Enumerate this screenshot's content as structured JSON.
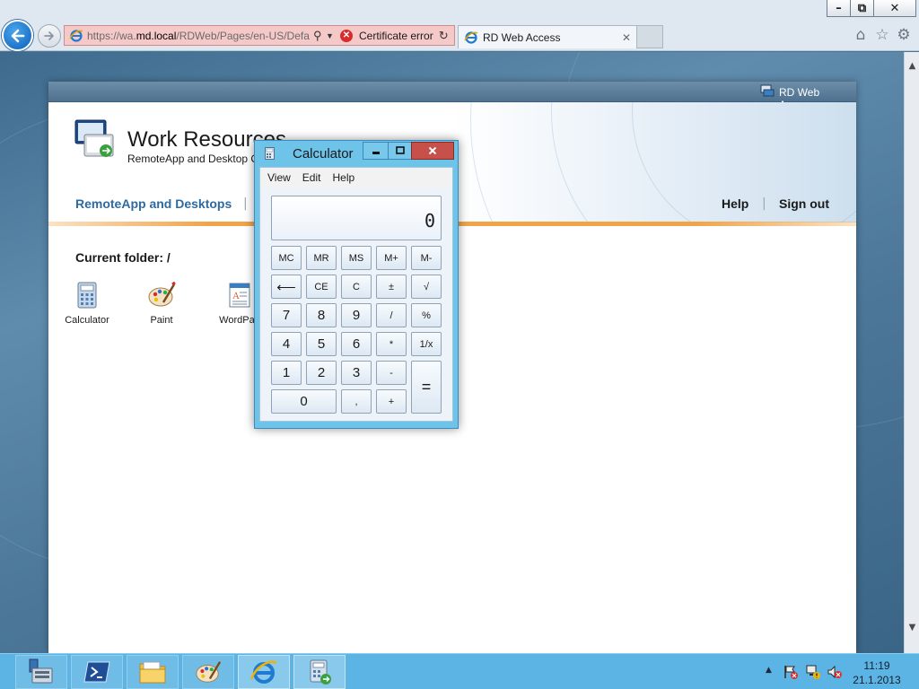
{
  "browser": {
    "address": {
      "url_prefix": "https://wa.",
      "url_host": "md.local",
      "url_path": "/RDWeb/Pages/en-US/Defa",
      "cert_error": "Certificate error"
    },
    "tab": {
      "label": "RD Web Access",
      "close": "✕"
    },
    "window_controls": {
      "minimize": "–",
      "restore": "⧉",
      "close": "✕"
    },
    "icons": [
      "home-icon",
      "favorites-icon",
      "gear-icon"
    ]
  },
  "page": {
    "topbar_title": "RD Web Access",
    "header_title": "Work Resources",
    "header_subtitle": "RemoteApp and Desktop C",
    "nav": {
      "remoteapp": "RemoteApp and Desktops",
      "separator": "|",
      "help": "Help",
      "signout": "Sign out"
    },
    "current_folder": "Current folder: /",
    "apps": [
      {
        "label": "Calculator"
      },
      {
        "label": "Paint"
      },
      {
        "label": "WordPad"
      }
    ]
  },
  "calculator": {
    "title": "Calculator",
    "menu": [
      "View",
      "Edit",
      "Help"
    ],
    "display": "0",
    "keys": {
      "memory": [
        "MC",
        "MR",
        "MS",
        "M+",
        "M-"
      ],
      "row2": [
        "⟵",
        "CE",
        "C",
        "±",
        "√"
      ],
      "row3": [
        "7",
        "8",
        "9",
        "/",
        "%"
      ],
      "row4": [
        "4",
        "5",
        "6",
        "*",
        "1/x"
      ],
      "row5": [
        "1",
        "2",
        "3",
        "-"
      ],
      "row6": [
        "0",
        ",",
        "+"
      ],
      "equals": "="
    }
  },
  "taskbar": {
    "time": "11:19",
    "date": "21.1.2013",
    "tray_arrow": "▲"
  },
  "colors": {
    "taskbar": "#5cb4e4",
    "calc_frame": "#6ec3e9",
    "cert_error_bg": "#f6c9c9",
    "nav_link": "#2d6aa0",
    "orange_rule": "#f1a348"
  }
}
